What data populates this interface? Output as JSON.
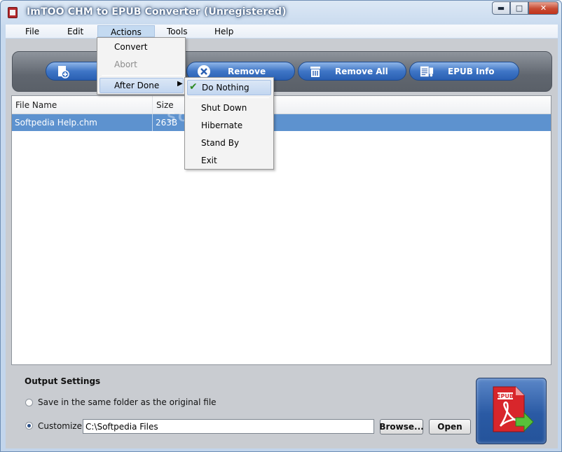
{
  "window": {
    "title": "ImTOO CHM to EPUB Converter (Unregistered)"
  },
  "menubar": {
    "items": [
      "File",
      "Edit",
      "Actions",
      "Tools",
      "Help"
    ]
  },
  "actions_menu": {
    "items": [
      {
        "label": "Convert",
        "enabled": true
      },
      {
        "label": "Abort",
        "enabled": false
      },
      {
        "label": "After Done",
        "enabled": true,
        "submenu": true
      }
    ]
  },
  "after_done_submenu": {
    "items": [
      "Do Nothing",
      "Shut Down",
      "Hibernate",
      "Stand By",
      "Exit"
    ],
    "checked": "Do Nothing"
  },
  "toolbar": {
    "buttons": [
      {
        "label": "",
        "icon": "add-file-icon"
      },
      {
        "label": "Remove",
        "icon": "remove-icon"
      },
      {
        "label": "Remove All",
        "icon": "trash-icon"
      },
      {
        "label": "EPUB Info",
        "icon": "info-icon"
      }
    ]
  },
  "watermark": "SOFTPEDIA",
  "file_list": {
    "columns": [
      "File Name",
      "Size"
    ],
    "rows": [
      {
        "name": "Softpedia Help.chm",
        "size": "263B"
      }
    ]
  },
  "output": {
    "title": "Output Settings",
    "option_same": "Save in the same folder as the original file",
    "option_customize": "Customize",
    "selected": "Customize",
    "path": "C:\\Softpedia Files",
    "browse_label": "Browse...",
    "open_label": "Open"
  },
  "convert_button": {
    "icon": "epub-pdf-convert-icon",
    "badge": "EPUB"
  },
  "colors": {
    "selection": "#5d92cf",
    "toolbar_button": "#3f76c6",
    "close_button": "#c84b33"
  }
}
